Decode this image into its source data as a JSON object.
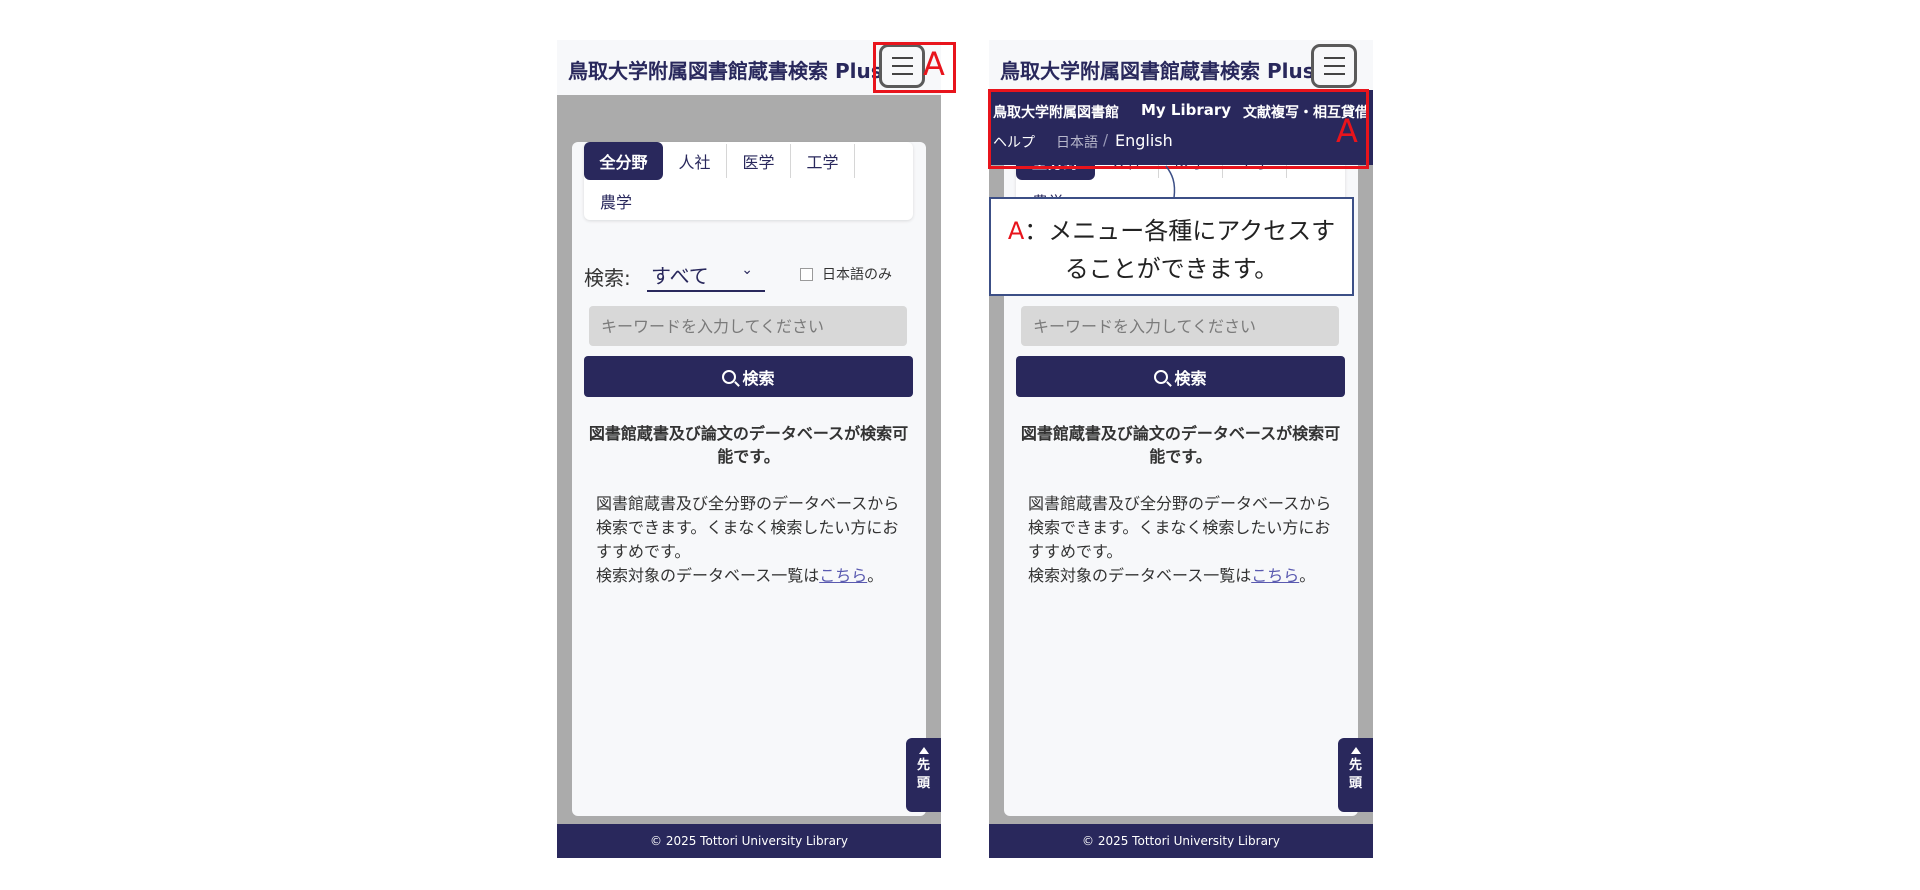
{
  "header": {
    "title": "鳥取大学附属図書館蔵書検索 Plus"
  },
  "tabs": [
    "全分野",
    "人社",
    "医学",
    "工学",
    "農学"
  ],
  "search": {
    "label": "検索:",
    "scope_value": "すべて",
    "chevron_icon": "chevron-down-icon",
    "japanese_only_label": "日本語のみ",
    "placeholder": "キーワードを入力してください",
    "button_label": "検索"
  },
  "description": {
    "title": "図書館蔵書及び論文のデータベースが検索可能です。",
    "body_line1": "図書館蔵書及び全分野のデータベースから検索できます。くまなく検索したい方におすすめです。",
    "body_line2_prefix": "検索対象のデータベース一覧は",
    "link_text": "こちら",
    "body_line2_suffix": "。"
  },
  "to_top": {
    "line1": "先",
    "line2": "頭"
  },
  "footer": {
    "copyright": "© 2025 Tottori University Library"
  },
  "menu": {
    "items": [
      "鳥取大学附属図書館",
      "My Library",
      "文献複写・相互貸借",
      "ヘルプ"
    ],
    "lang_ja": "日本語",
    "lang_sep": "/",
    "lang_en": "English"
  },
  "annotation": {
    "marker": "A",
    "callout_letter": "A",
    "callout_text_1": "：メニュー各種にアクセスす",
    "callout_text_2": "ることができます。"
  },
  "colors": {
    "brand": "#29285c",
    "annotation": "#e8141c",
    "background": "#ababab"
  }
}
